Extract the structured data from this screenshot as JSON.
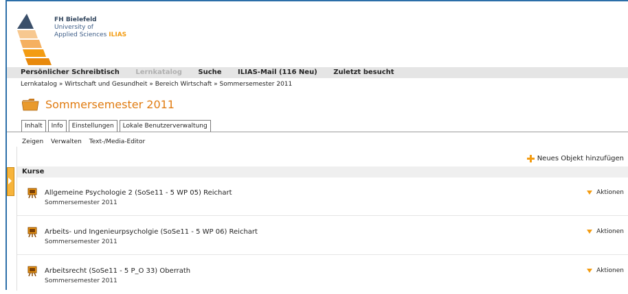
{
  "brand": {
    "line1": "FH Bielefeld",
    "line2": "University of",
    "line3": "Applied Sciences",
    "ilias": "ILIAS"
  },
  "menu": {
    "items": [
      "Persönlicher Schreibtisch",
      "Lernkatalog",
      "Suche",
      "ILIAS-Mail (116 Neu)",
      "Zuletzt besucht"
    ]
  },
  "breadcrumb": "Lernkatalog » Wirtschaft und Gesundheit » Bereich Wirtschaft » Sommersemester 2011",
  "page": {
    "title": "Sommersemester 2011"
  },
  "tabs": [
    "Inhalt",
    "Info",
    "Einstellungen",
    "Lokale Benutzerverwaltung"
  ],
  "subtabs": [
    "Zeigen",
    "Verwalten",
    "Text-/Media-Editor"
  ],
  "add_object": "Neues Objekt hinzufügen",
  "section": {
    "title": "Kurse"
  },
  "courses": [
    {
      "name": "Allgemeine Psychologie 2 (SoSe11 - 5 WP 05) Reichart",
      "sub": "Sommersemester 2011",
      "actions": "Aktionen"
    },
    {
      "name": "Arbeits- und Ingenieurpsycholgie (SoSe11 - 5 WP 06) Reichart",
      "sub": "Sommersemester 2011",
      "actions": "Aktionen"
    },
    {
      "name": "Arbeitsrecht (SoSe11 - 5 P_O 33) Oberrath",
      "sub": "Sommersemester 2011",
      "actions": "Aktionen"
    }
  ],
  "colors": {
    "accent": "#e07b10",
    "link_blue": "#2b6ea8",
    "menu_bg": "#e5e5e5"
  }
}
